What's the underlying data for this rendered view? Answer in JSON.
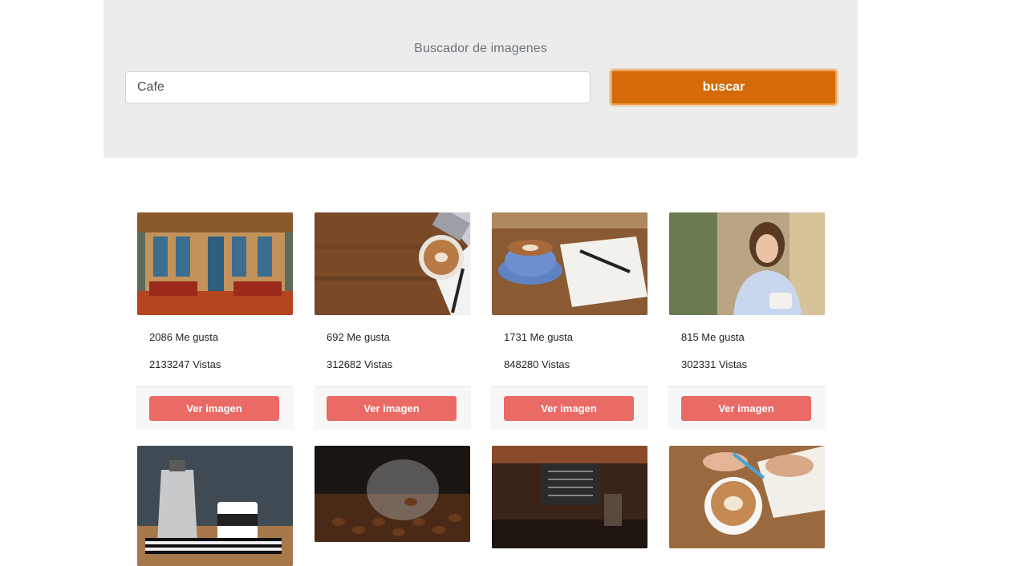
{
  "search": {
    "title": "Buscador de imagenes",
    "value": "Cafe",
    "button_label": "buscar"
  },
  "cards": [
    {
      "likes": "2086 Me gusta",
      "views": "2133247 Vistas",
      "button": "Ver imagen",
      "image": "cafe-street-terrace"
    },
    {
      "likes": "692 Me gusta",
      "views": "312682 Vistas",
      "button": "Ver imagen",
      "image": "latte-laptop-desk"
    },
    {
      "likes": "1731 Me gusta",
      "views": "848280 Vistas",
      "button": "Ver imagen",
      "image": "coffee-cup-notebook"
    },
    {
      "likes": "815 Me gusta",
      "views": "302331 Vistas",
      "button": "Ver imagen",
      "image": "woman-phone-cafe"
    },
    {
      "image": "moka-pot-mug"
    },
    {
      "image": "coffee-beans-glass"
    },
    {
      "image": "coffee-shop-counter"
    },
    {
      "image": "latte-hands-notes"
    }
  ],
  "colors": {
    "accent": "#d46b08",
    "card_button": "#ea6a66",
    "jumbotron": "#ececec"
  }
}
